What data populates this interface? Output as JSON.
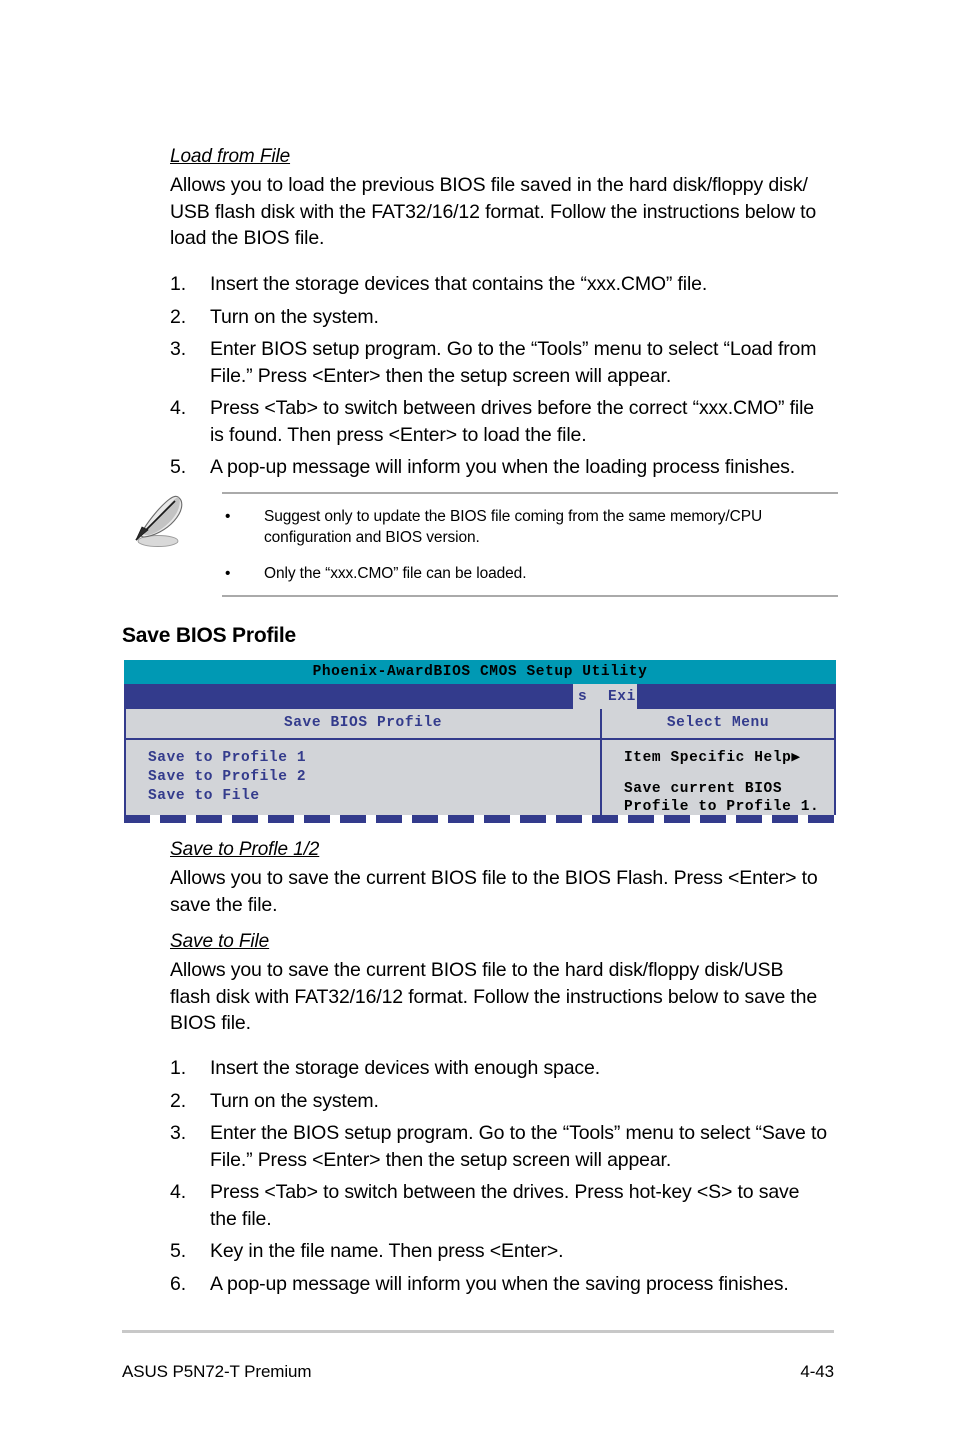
{
  "page": {
    "footer_left": "ASUS P5N72-T Premium",
    "footer_page_number": "4-43"
  },
  "load_from_file": {
    "heading": "Load from File",
    "paragraph_lines": [
      "Allows you to load the previous BIOS file saved in the hard disk/floppy disk/",
      "USB flash disk with the FAT32/16/12 format. Follow the instructions below to",
      "load the BIOS file."
    ],
    "steps": [
      {
        "number": "1.",
        "lines": [
          "Insert the storage devices that contains the “xxx.CMO” file."
        ]
      },
      {
        "number": "2.",
        "lines": [
          "Turn on the system."
        ]
      },
      {
        "number": "3.",
        "lines": [
          "Enter BIOS setup program. Go to the “Tools” menu to select “Load from",
          "File.” Press <Enter> then the setup screen will appear."
        ]
      },
      {
        "number": "4.",
        "lines": [
          "Press <Tab> to switch between drives before the correct “xxx.CMO” file",
          "is found. Then press <Enter> to load the file."
        ]
      },
      {
        "number": "5.",
        "lines": [
          "A pop-up message will inform you when the loading process finishes."
        ]
      }
    ]
  },
  "note": {
    "icon": "quill-pen-icon",
    "bullet_glyph": "•",
    "bullets": [
      {
        "lines": [
          "Suggest only to update the BIOS file coming from the same memory/CPU",
          "configuration and BIOS version."
        ]
      },
      {
        "lines": [
          "Only the “xxx.CMO” file can be loaded."
        ]
      }
    ]
  },
  "save_bios_profile": {
    "section_title": "Save BIOS Profile",
    "bios_screen": {
      "title_bar": "Phoenix-AwardBIOS CMOS Setup Utility",
      "menu_bar": {
        "visible_fragment_left": "s",
        "visible_fragment_right": "Exi"
      },
      "left_panel": {
        "header": "Save BIOS Profile",
        "items": [
          "Save to Profile 1",
          "Save to Profile 2",
          "Save to File"
        ]
      },
      "right_panel": {
        "header": "Select Menu",
        "help_title": "Item Specific Help▶",
        "help_lines": [
          "Save current BIOS",
          "Profile to Profile 1."
        ]
      },
      "colors": {
        "title_bar": "#0099b4",
        "menu_bar": "#333b8c",
        "panel_background": "#d2d4d8",
        "panel_text": "#333b8c",
        "help_text": "#000000"
      }
    }
  },
  "save_to_profile": {
    "heading": "Save to Profle 1/2",
    "paragraph_lines": [
      "Allows you to save the current BIOS file to the BIOS Flash. Press <Enter> to",
      "save the file."
    ]
  },
  "save_to_file": {
    "heading": "Save to File",
    "paragraph_lines": [
      "Allows you to save the current BIOS file to the hard disk/floppy disk/USB",
      "flash disk with FAT32/16/12 format. Follow the instructions below to save the",
      "BIOS file."
    ],
    "steps": [
      {
        "number": "1.",
        "lines": [
          "Insert the storage devices with enough space."
        ]
      },
      {
        "number": "2.",
        "lines": [
          "Turn on the system."
        ]
      },
      {
        "number": "3.",
        "lines": [
          "Enter the BIOS setup program. Go to the “Tools” menu to select “Save to",
          "File.” Press <Enter> then the setup screen will appear."
        ]
      },
      {
        "number": "4.",
        "lines": [
          "Press <Tab> to switch between the drives. Press hot-key <S> to save",
          "the file."
        ]
      },
      {
        "number": "5.",
        "lines": [
          "Key in the file name. Then press <Enter>."
        ]
      },
      {
        "number": "6.",
        "lines": [
          "A pop-up message will inform you when the saving process finishes."
        ]
      }
    ]
  }
}
